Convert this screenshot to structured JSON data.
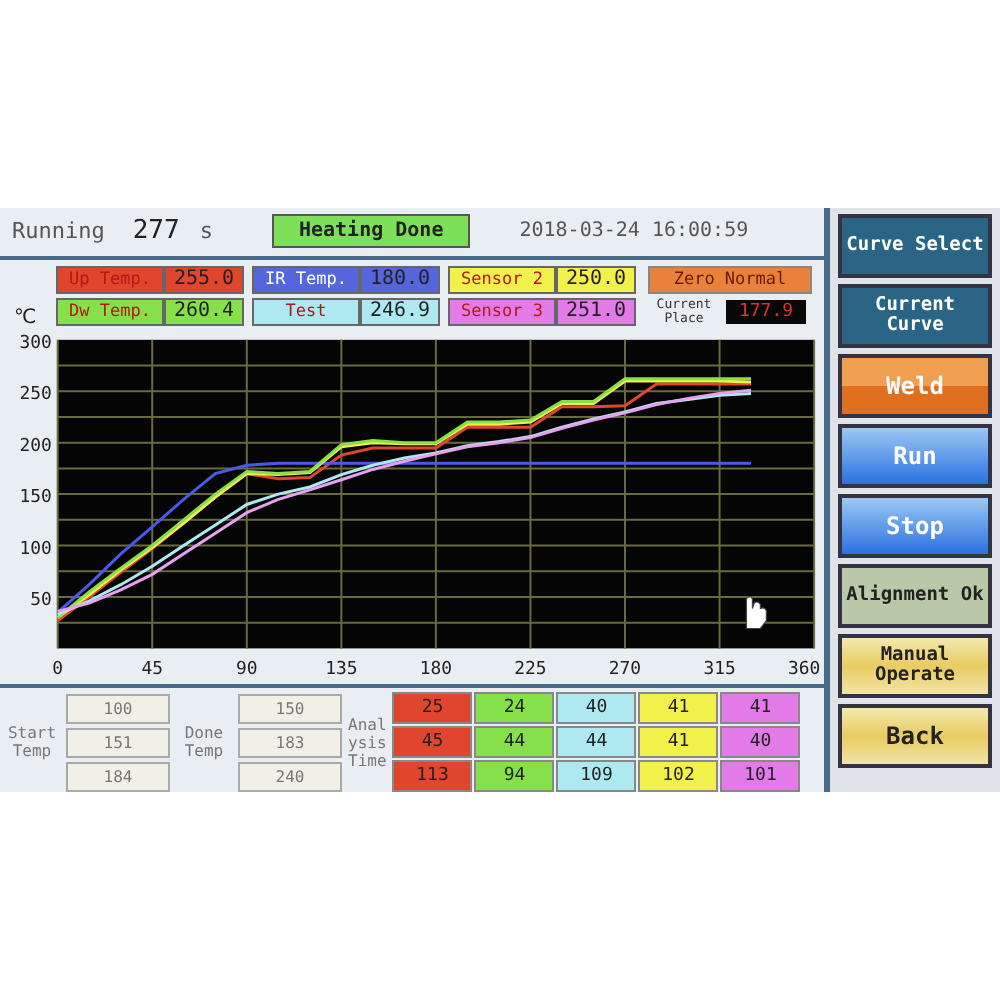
{
  "header": {
    "running_label": "Running",
    "running_value": "277",
    "running_unit": "s",
    "status": "Heating Done",
    "datetime": "2018-03-24 16:00:59"
  },
  "sensors": [
    {
      "label": "Up Temp.",
      "value": "255.0",
      "color": "#e0452e"
    },
    {
      "label": "IR Temp.",
      "value": "180.0",
      "color": "#5566dd"
    },
    {
      "label": "Sensor 2",
      "value": "250.0",
      "color": "#f2f04a"
    },
    {
      "label": "Dw Temp.",
      "value": "260.4",
      "color": "#86e04a"
    },
    {
      "label": "Test",
      "value": "246.9",
      "color": "#aee8f0"
    },
    {
      "label": "Sensor 3",
      "value": "251.0",
      "color": "#e27ae8"
    }
  ],
  "zero_status": "Zero Normal",
  "current_place": {
    "label": "Current Place",
    "value": "177.9"
  },
  "chart": {
    "chart_data": {
      "type": "line",
      "grid": true,
      "ylabel": "℃",
      "x": [
        0,
        15,
        30,
        45,
        60,
        75,
        90,
        105,
        120,
        135,
        150,
        165,
        180,
        195,
        210,
        225,
        240,
        255,
        270,
        285,
        300,
        315,
        330
      ],
      "xlim": [
        0,
        360
      ],
      "ylim": [
        0,
        300
      ],
      "xticks": [
        0,
        45,
        90,
        135,
        180,
        225,
        270,
        315,
        360
      ],
      "yticks": [
        50,
        100,
        150,
        200,
        250,
        300
      ],
      "series": [
        {
          "color": "#e0452e",
          "values": [
            27,
            50,
            74,
            97,
            122,
            147,
            170,
            165,
            166,
            188,
            195,
            195,
            195,
            215,
            215,
            215,
            235,
            235,
            236,
            257,
            257,
            257,
            257
          ]
        },
        {
          "color": "#4a5ae8",
          "values": [
            35,
            62,
            92,
            118,
            145,
            170,
            178,
            180,
            180,
            180,
            180,
            180,
            180,
            180,
            180,
            180,
            180,
            180,
            180,
            180,
            180,
            180,
            180
          ]
        },
        {
          "color": "#f2f04a",
          "values": [
            30,
            52,
            76,
            98,
            122,
            147,
            170,
            169,
            171,
            196,
            200,
            199,
            199,
            218,
            218,
            220,
            238,
            238,
            260,
            260,
            260,
            260,
            259
          ]
        },
        {
          "color": "#86e04a",
          "values": [
            30,
            55,
            78,
            100,
            125,
            150,
            172,
            170,
            172,
            198,
            202,
            200,
            200,
            220,
            220,
            222,
            240,
            240,
            262,
            262,
            262,
            262,
            262
          ]
        },
        {
          "color": "#aee8f0",
          "values": [
            33,
            46,
            62,
            80,
            100,
            120,
            140,
            150,
            157,
            169,
            178,
            185,
            190,
            197,
            201,
            206,
            215,
            223,
            230,
            238,
            242,
            246,
            248
          ]
        },
        {
          "color": "#e8a0f0",
          "values": [
            36,
            44,
            57,
            72,
            92,
            112,
            132,
            145,
            154,
            164,
            174,
            182,
            189,
            196,
            200,
            205,
            214,
            222,
            229,
            237,
            243,
            248,
            251
          ]
        }
      ]
    }
  },
  "start_temp": {
    "label": "Start Temp",
    "values": [
      "100",
      "151",
      "184"
    ]
  },
  "done_temp": {
    "label": "Done Temp",
    "values": [
      "150",
      "183",
      "240"
    ]
  },
  "analysis": {
    "label": "Analysis Time",
    "columns": [
      {
        "color": "#e0452e",
        "values": [
          "25",
          "45",
          "113"
        ]
      },
      {
        "color": "#86e04a",
        "values": [
          "24",
          "44",
          "94"
        ]
      },
      {
        "color": "#aee8f0",
        "values": [
          "40",
          "44",
          "109"
        ]
      },
      {
        "color": "#f2f04a",
        "values": [
          "41",
          "41",
          "102"
        ]
      },
      {
        "color": "#e27ae8",
        "values": [
          "41",
          "40",
          "101"
        ]
      }
    ]
  },
  "buttons": [
    {
      "label": "Curve Select",
      "kind": "dark"
    },
    {
      "label": "Current Curve",
      "kind": "dark"
    },
    {
      "label": "Weld",
      "kind": "orange"
    },
    {
      "label": "Run",
      "kind": "blue"
    },
    {
      "label": "Stop",
      "kind": "blue"
    },
    {
      "label": "Alignment Ok",
      "kind": "grey"
    },
    {
      "label": "Manual Operate",
      "kind": "yellow"
    },
    {
      "label": "Back",
      "kind": "yellow"
    }
  ]
}
